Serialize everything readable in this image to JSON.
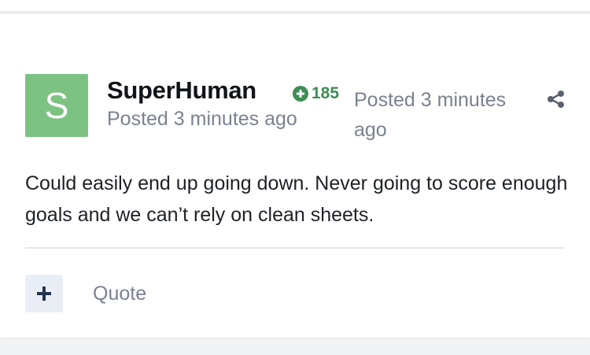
{
  "post": {
    "avatar_letter": "S",
    "author": "SuperHuman",
    "reputation": "185",
    "posted_inline": "Posted 3 minutes ago",
    "posted_side": "Posted 3 minutes ago",
    "content": "Could easily end up going down. Never going to score enough goals and we can’t rely on clean sheets.",
    "quote_label": "Quote",
    "icons": {
      "reputation": "plus-circle-icon",
      "share": "share-icon",
      "add": "plus-icon"
    }
  },
  "colors": {
    "avatar_bg": "#7cc383",
    "reputation": "#3f8d54",
    "muted_text": "#7a8290"
  }
}
